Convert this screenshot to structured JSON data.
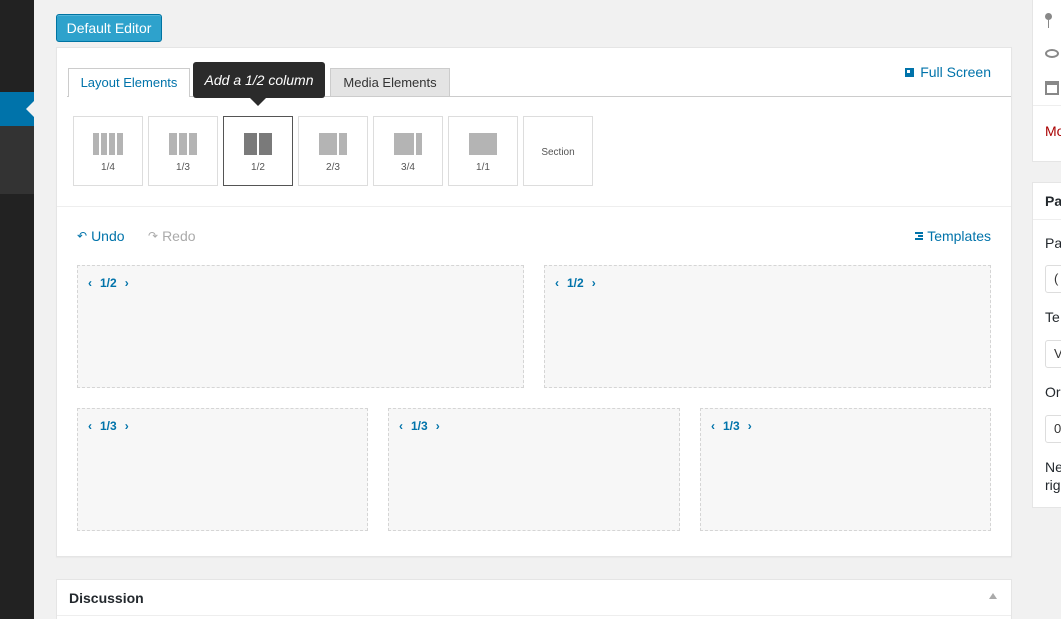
{
  "editor": {
    "default_editor_label": "Default Editor"
  },
  "builder": {
    "tabs": [
      {
        "label": "Layout Elements"
      },
      {
        "label": "Media Elements"
      }
    ],
    "tooltip": "Add a 1/2 column",
    "fullscreen_label": "Full Screen",
    "elements": [
      {
        "label": "1/4"
      },
      {
        "label": "1/3"
      },
      {
        "label": "1/2"
      },
      {
        "label": "2/3"
      },
      {
        "label": "3/4"
      },
      {
        "label": "1/1"
      },
      {
        "label": "Section"
      }
    ],
    "undo_label": "Undo",
    "redo_label": "Redo",
    "templates_label": "Templates",
    "columns": [
      {
        "label": "1/2"
      },
      {
        "label": "1/2"
      },
      {
        "label": "1/3"
      },
      {
        "label": "1/3"
      },
      {
        "label": "1/3"
      }
    ]
  },
  "discussion": {
    "title": "Discussion"
  },
  "right_sidebar": {
    "move_text": "Mo",
    "panel_title": "Pa",
    "parent_label": "Pa",
    "parent_value": "(",
    "template_label": "Te",
    "template_value": "V",
    "order_label": "Or",
    "order_value": "0",
    "help_line1": "Ne",
    "help_line2": "rig"
  },
  "colors": {
    "accent": "#0073aa",
    "button": "#2ea2cc",
    "admin_bar": "#222222"
  }
}
